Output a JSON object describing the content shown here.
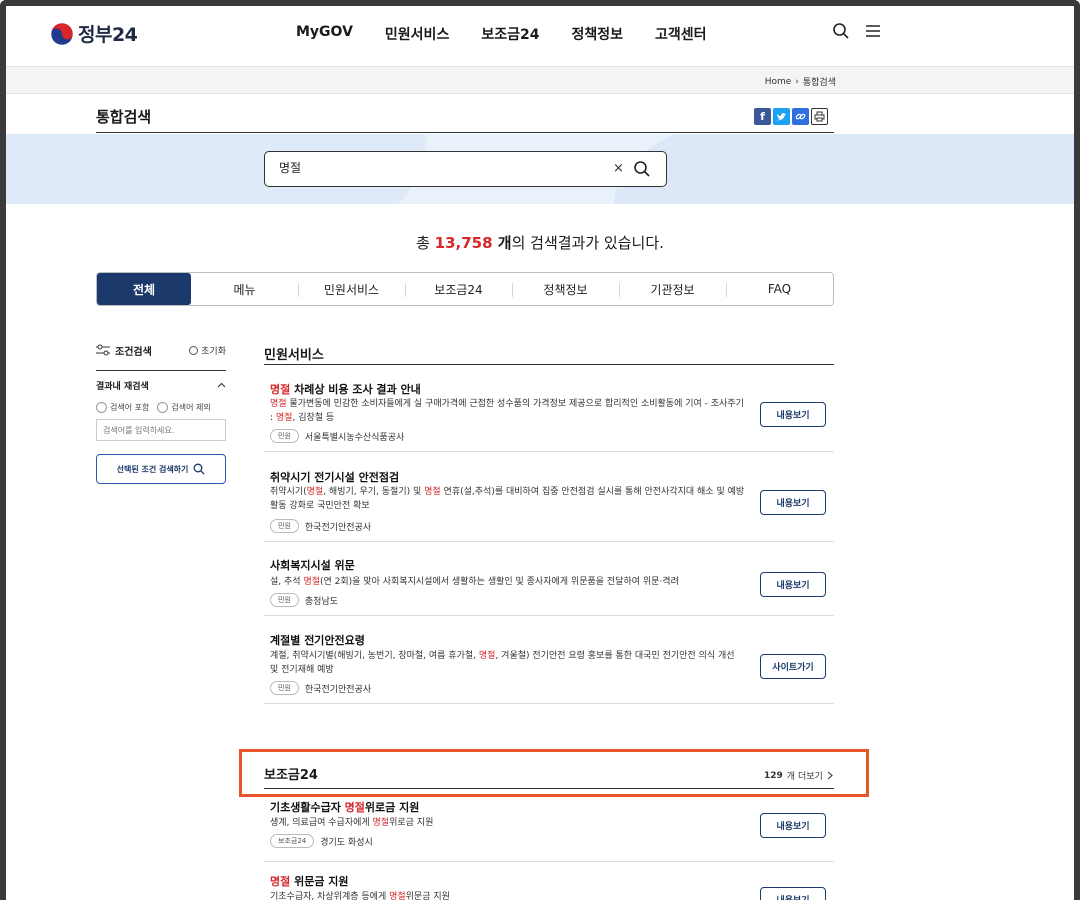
{
  "header": {
    "logo_text": "정부24",
    "nav": [
      "MyGOV",
      "민원서비스",
      "보조금24",
      "정책정보",
      "고객센터"
    ]
  },
  "breadcrumb": [
    "Home",
    "통합검색"
  ],
  "page_title": "통합검색",
  "search": {
    "value": "명절",
    "clear": "×"
  },
  "result": {
    "prefix": "총 ",
    "count": "13,758",
    "unit": " 개",
    "suffix": "의 검색결과가 있습니다."
  },
  "tabs": [
    "전체",
    "메뉴",
    "민원서비스",
    "보조금24",
    "정책정보",
    "기관정보",
    "FAQ"
  ],
  "sidebar": {
    "title": "조건검색",
    "reset": "초기화",
    "subtitle": "결과내 재검색",
    "radio_include": "검색어 포함",
    "radio_exclude": "검색어 제외",
    "input_placeholder": "검색어를 입력하세요.",
    "search_button": "선택된 조건 검색하기"
  },
  "civil_section": {
    "title": "민원서비스",
    "items": [
      {
        "title_hl": "명절",
        "title_rest": " 차례상 비용 조사 결과 안내",
        "desc_hl1": "명절",
        "desc_1": " 물가변동에 민감한 소비자들에게 실 구매가격에 근접한 성수품의 가격정보 제공으로 합리적인 소비활동에 기여 - 조사주기 : ",
        "desc_hl2": "명절",
        "desc_2": ", 김장철 등",
        "tag": "민원",
        "org": "서울특별시농수산식품공사",
        "button": "내용보기"
      },
      {
        "title_plain": "취약시기 전기시설 안전점검",
        "desc_1": "취약시기(",
        "desc_hl1": "명절",
        "desc_2": ", 해빙기, 우기, 동절기) 및 ",
        "desc_hl2": "명절",
        "desc_3": " 연휴(설,추석)를 대비하여 집중 안전점검 실시를 통해 안전사각지대 해소 및 예방활동 강화로 국민안전 확보",
        "tag": "민원",
        "org": "한국전기안전공사",
        "button": "내용보기"
      },
      {
        "title_plain": "사회복지시설 위문",
        "desc_1": "설, 추석 ",
        "desc_hl1": "명절",
        "desc_2": "(연 2회)을 맞아 사회복지시설에서 생활하는 생활인 및 종사자에게 위문품을 전달하여 위문·격려",
        "tag": "민원",
        "org": "충청남도",
        "button": "내용보기"
      },
      {
        "title_plain": "계절별 전기안전요령",
        "desc_1": "계절, 취약시기별(해빙기, 농번기, 장마철, 여름 휴가철, ",
        "desc_hl1": "명절",
        "desc_2": ", 겨울철) 전기안전 요령 홍보를 통한 대국민 전기안전 의식 개선 및 전기재해 예방",
        "tag": "민원",
        "org": "한국전기안전공사",
        "button": "사이트가기"
      }
    ]
  },
  "subsidy_section": {
    "title": "보조금24",
    "more_count": "129",
    "more_label": " 개 더보기",
    "items": [
      {
        "title_pre": "기초생활수급자 ",
        "title_hl": "명절",
        "title_post": "위로금 지원",
        "desc_1": "생계, 의료급여 수급자에게 ",
        "desc_hl1": "명절",
        "desc_2": "위로금 지원",
        "tag": "보조금24",
        "org": "경기도 화성시",
        "button": "내용보기"
      },
      {
        "title_hl": "명절",
        "title_post": " 위문금 지원",
        "desc_1": "기초수급자, 차상위계층 등에게 ",
        "desc_hl1": "명절",
        "desc_2": "위문금 지원",
        "button": "내용보기"
      }
    ]
  },
  "colors": {
    "navy": "#1b3a6b",
    "highlight": "#d6272b",
    "callout": "#e8552b"
  }
}
